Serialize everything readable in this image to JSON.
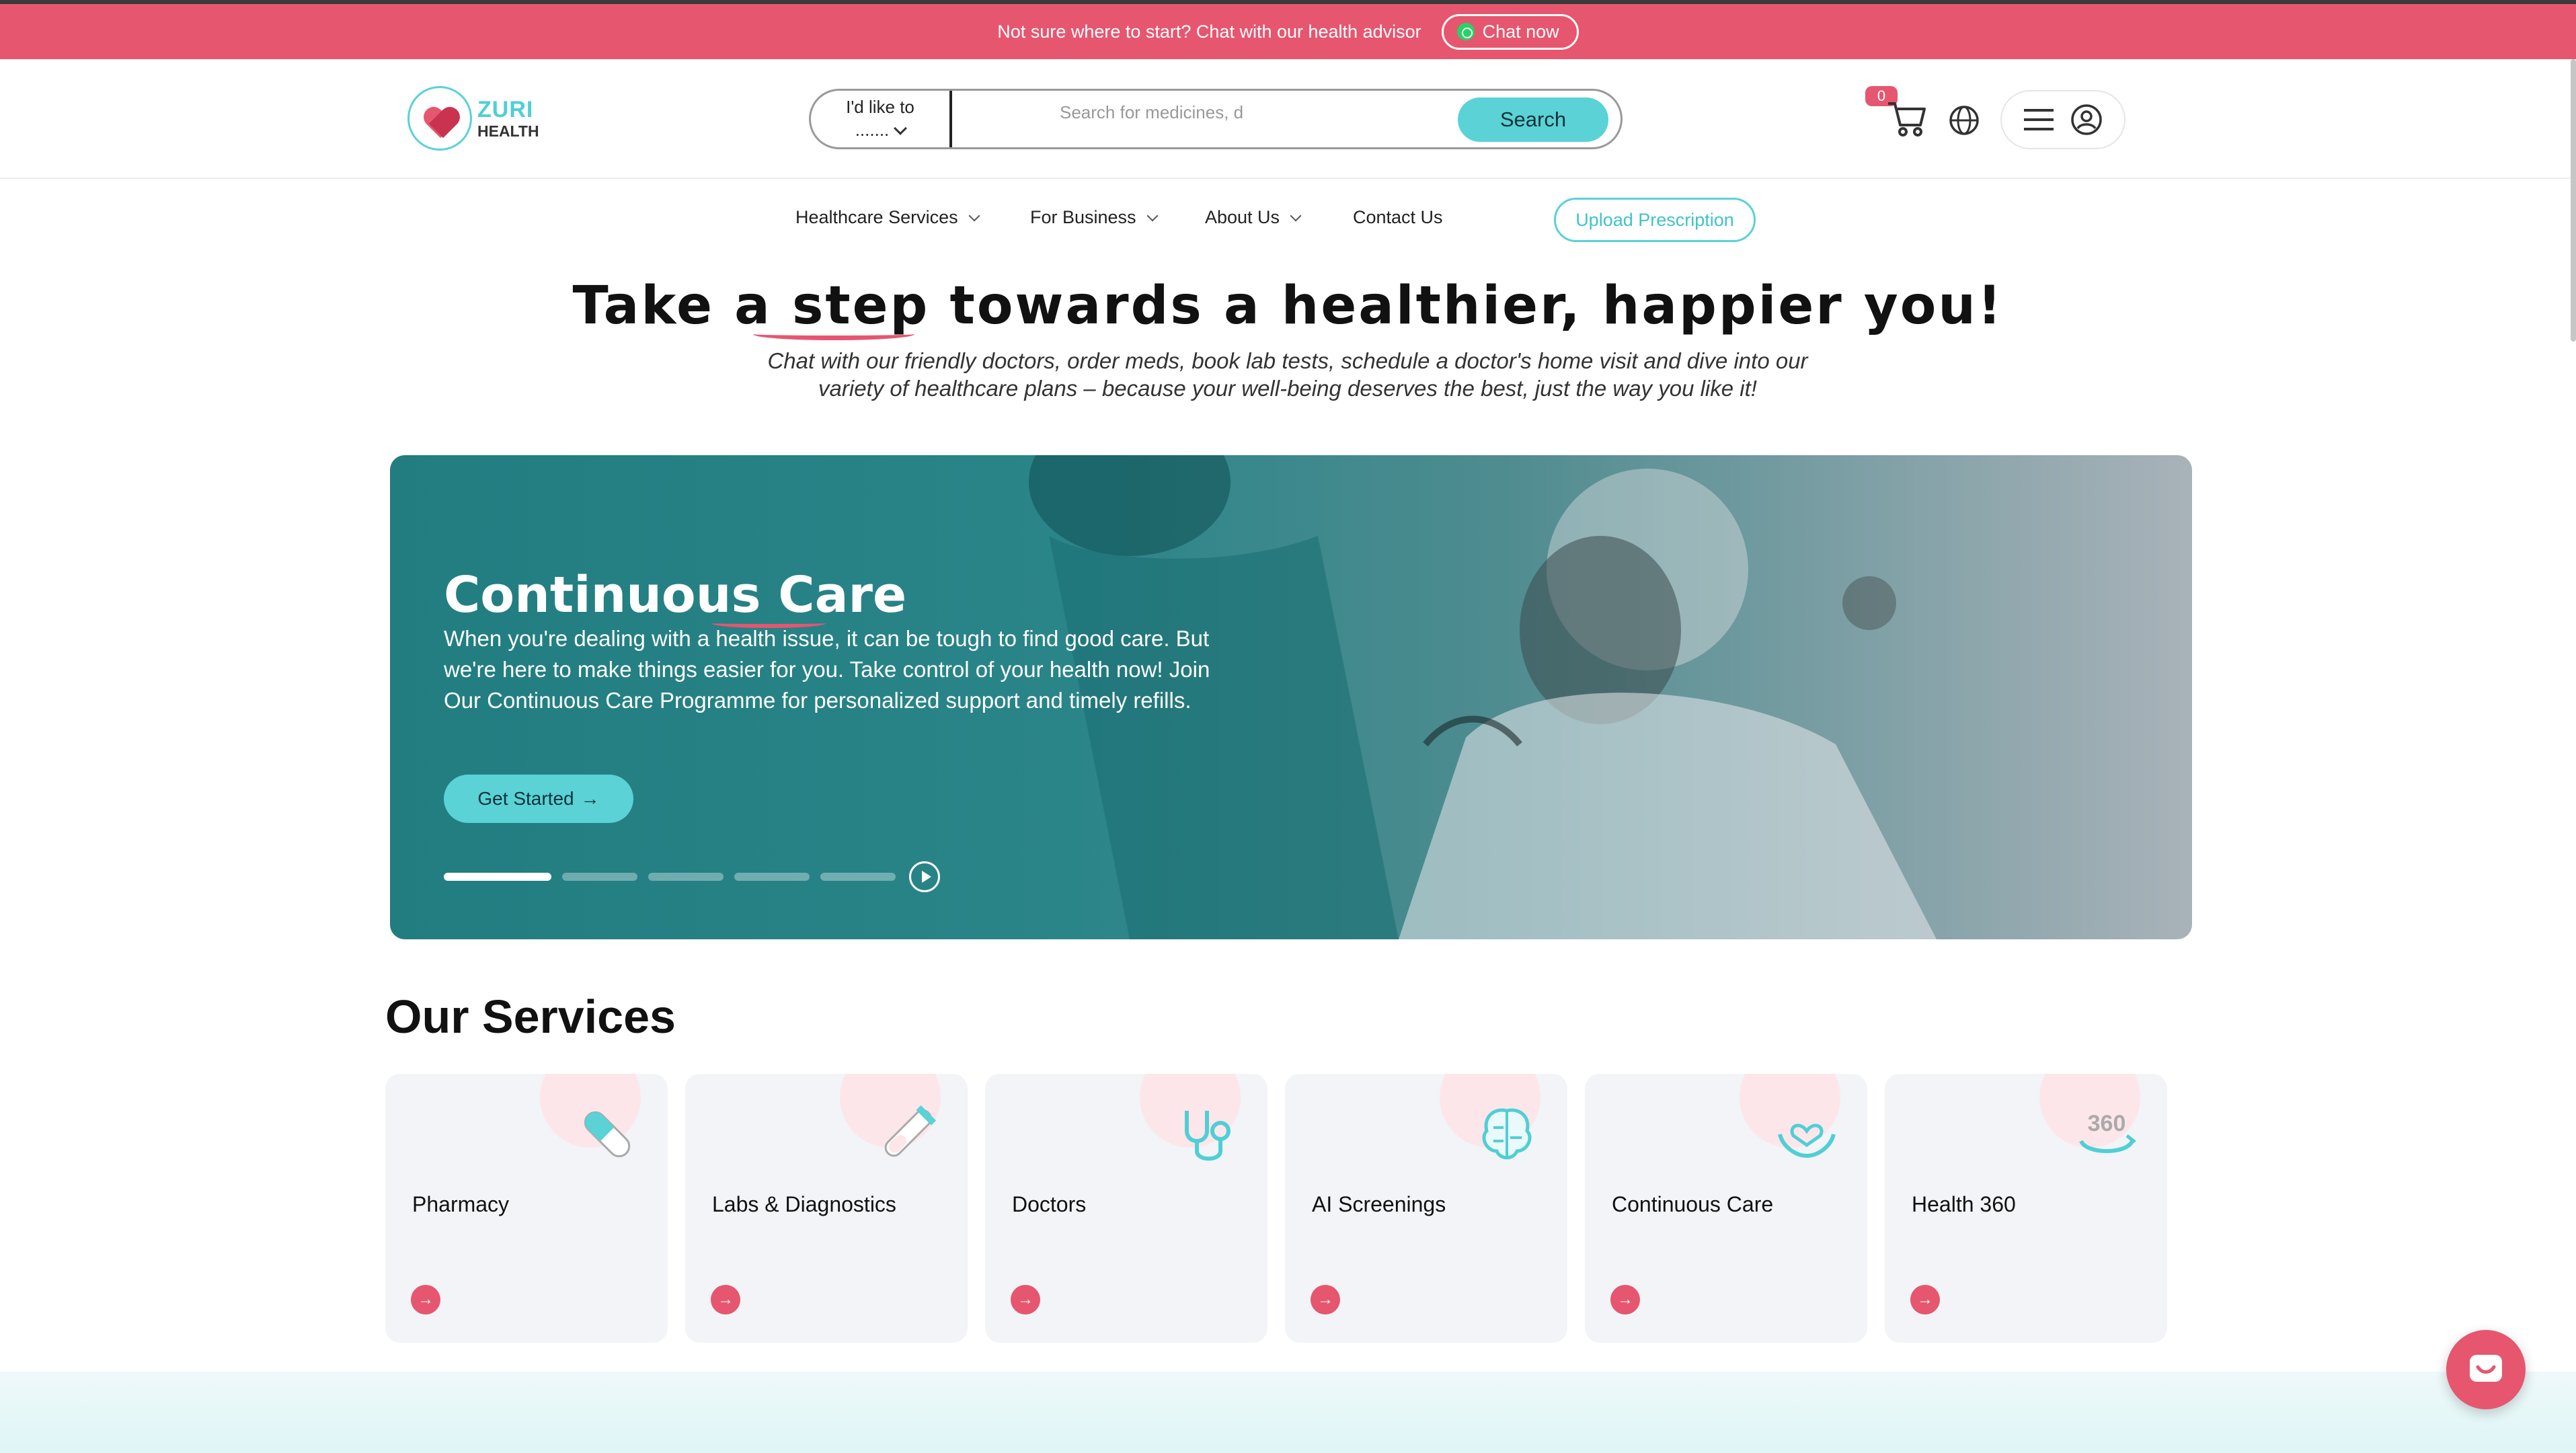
{
  "announcement": {
    "text": "Not sure where to start? Chat with our health advisor",
    "chat_label": "Chat now"
  },
  "brand": {
    "name": "ZURI",
    "sub": "HEALTH"
  },
  "search": {
    "like_to_label": "I'd like to",
    "like_to_value": ".......",
    "placeholder": "Search for medicines, d",
    "button": "Search"
  },
  "cart": {
    "count": "0"
  },
  "nav": {
    "items": [
      "Healthcare Services",
      "For Business",
      "About Us",
      "Contact Us"
    ],
    "upload": "Upload Prescription"
  },
  "hero": {
    "title": "Take a step towards a healthier, happier you!",
    "subtitle": "Chat with our friendly doctors, order meds, book lab tests, schedule a doctor's home visit and dive into our variety of healthcare plans – because your well-being deserves the best, just the way you like it!"
  },
  "banner": {
    "title": "Continuous Care",
    "text": "When you're dealing with a health issue, it can be tough to find good care. But we're here to make things easier for you. Take control of your health now! Join Our Continuous Care Programme for personalized support and timely refills.",
    "button": "Get Started"
  },
  "services": {
    "title": "Our Services",
    "items": [
      {
        "label": "Pharmacy",
        "icon": "pill-icon"
      },
      {
        "label": "Labs & Diagnostics",
        "icon": "test-tube-icon"
      },
      {
        "label": "Doctors",
        "icon": "stethoscope-icon"
      },
      {
        "label": "AI Screenings",
        "icon": "brain-icon"
      },
      {
        "label": "Continuous Care",
        "icon": "heart-hands-icon"
      },
      {
        "label": "Health 360",
        "icon": "health-360-icon",
        "icon_text": "360"
      }
    ]
  },
  "colors": {
    "brand_pink": "#e6566f",
    "brand_teal": "#5ad2d6"
  }
}
